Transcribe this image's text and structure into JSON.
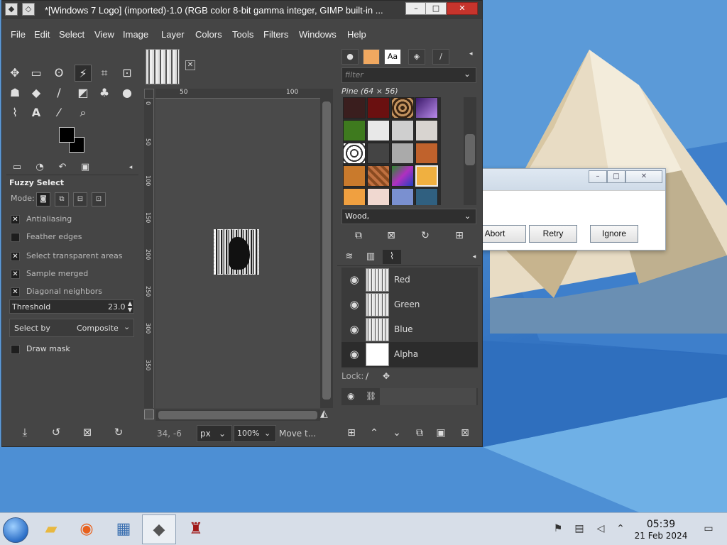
{
  "window": {
    "title": "*[Windows 7 Logo] (imported)-1.0 (RGB color 8-bit gamma integer, GIMP built-in ...",
    "minimize": "–",
    "maximize": "□",
    "close": "✕"
  },
  "menu": [
    "File",
    "Edit",
    "Select",
    "View",
    "Image",
    "Layer",
    "Colors",
    "Tools",
    "Filters",
    "Windows",
    "Help"
  ],
  "tool_options": {
    "title": "Fuzzy Select",
    "mode_label": "Mode:",
    "antialiasing": "Antialiasing",
    "feather_edges": "Feather edges",
    "select_transparent": "Select transparent areas",
    "sample_merged": "Sample merged",
    "diagonal_neighbors": "Diagonal neighbors",
    "threshold_label": "Threshold",
    "threshold_value": "23.0",
    "select_by_label": "Select by",
    "select_by_value": "Composite",
    "draw_mask": "Draw mask"
  },
  "ruler": {
    "h_ticks": [
      "50",
      "100"
    ],
    "v_ticks": [
      "0",
      "50",
      "100",
      "150",
      "200",
      "250",
      "300",
      "350"
    ]
  },
  "status": {
    "coords": "34, -6",
    "unit": "px",
    "zoom": "100%",
    "message": "Move t..."
  },
  "patterns": {
    "filter_placeholder": "filter",
    "title": "Pine (64 × 56)",
    "tag": "Wood,"
  },
  "layers": [
    {
      "name": "Red"
    },
    {
      "name": "Green"
    },
    {
      "name": "Blue"
    },
    {
      "name": "Alpha"
    }
  ],
  "lock_label": "Lock:",
  "dialog": {
    "abort": "Abort",
    "retry": "Retry",
    "ignore": "Ignore"
  },
  "taskbar": {
    "time": "05:39",
    "date": "21 Feb 2024"
  }
}
